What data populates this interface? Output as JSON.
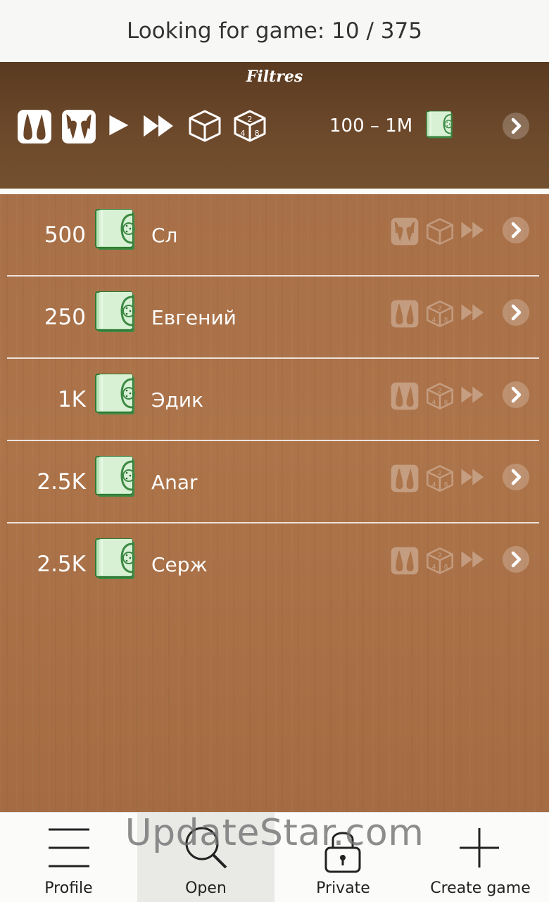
{
  "status": {
    "text": "Looking for game: 10 / 375"
  },
  "filters": {
    "title": "Filtres",
    "range": "100 – 1M",
    "icons": [
      "short-backgammon-icon",
      "long-backgammon-icon",
      "play-icon",
      "fast-forward-icon",
      "cube-icon",
      "numbered-dice-icon",
      "cash-icon",
      "chevron-right-icon"
    ]
  },
  "games": [
    {
      "amount": "500",
      "name": "Сл",
      "mode_icon": "long-backgammon-icon",
      "dice_icon": "cube-icon",
      "speed_icon": "fast-forward-icon"
    },
    {
      "amount": "250",
      "name": "Евгений",
      "mode_icon": "short-backgammon-icon",
      "dice_icon": "numbered-dice-icon",
      "speed_icon": "fast-forward-icon"
    },
    {
      "amount": "1K",
      "name": "Эдик",
      "mode_icon": "short-backgammon-icon",
      "dice_icon": "numbered-dice-icon",
      "speed_icon": "fast-forward-icon"
    },
    {
      "amount": "2.5K",
      "name": "Anar",
      "mode_icon": "short-backgammon-icon",
      "dice_icon": "numbered-dice-icon",
      "speed_icon": "fast-forward-icon"
    },
    {
      "amount": "2.5K",
      "name": "Серж",
      "mode_icon": "short-backgammon-icon",
      "dice_icon": "numbered-dice-icon",
      "speed_icon": "fast-forward-icon"
    }
  ],
  "nav": [
    {
      "label": "Profile",
      "icon": "menu-icon"
    },
    {
      "label": "Open",
      "icon": "search-icon",
      "active": true
    },
    {
      "label": "Private",
      "icon": "lock-icon"
    },
    {
      "label": "Create game",
      "icon": "plus-icon"
    }
  ],
  "watermark": "UpdateStar.com",
  "colors": {
    "wood": "#a87048",
    "filter_bar": "#5a3a20",
    "cash_green": "#2f8a3f"
  }
}
